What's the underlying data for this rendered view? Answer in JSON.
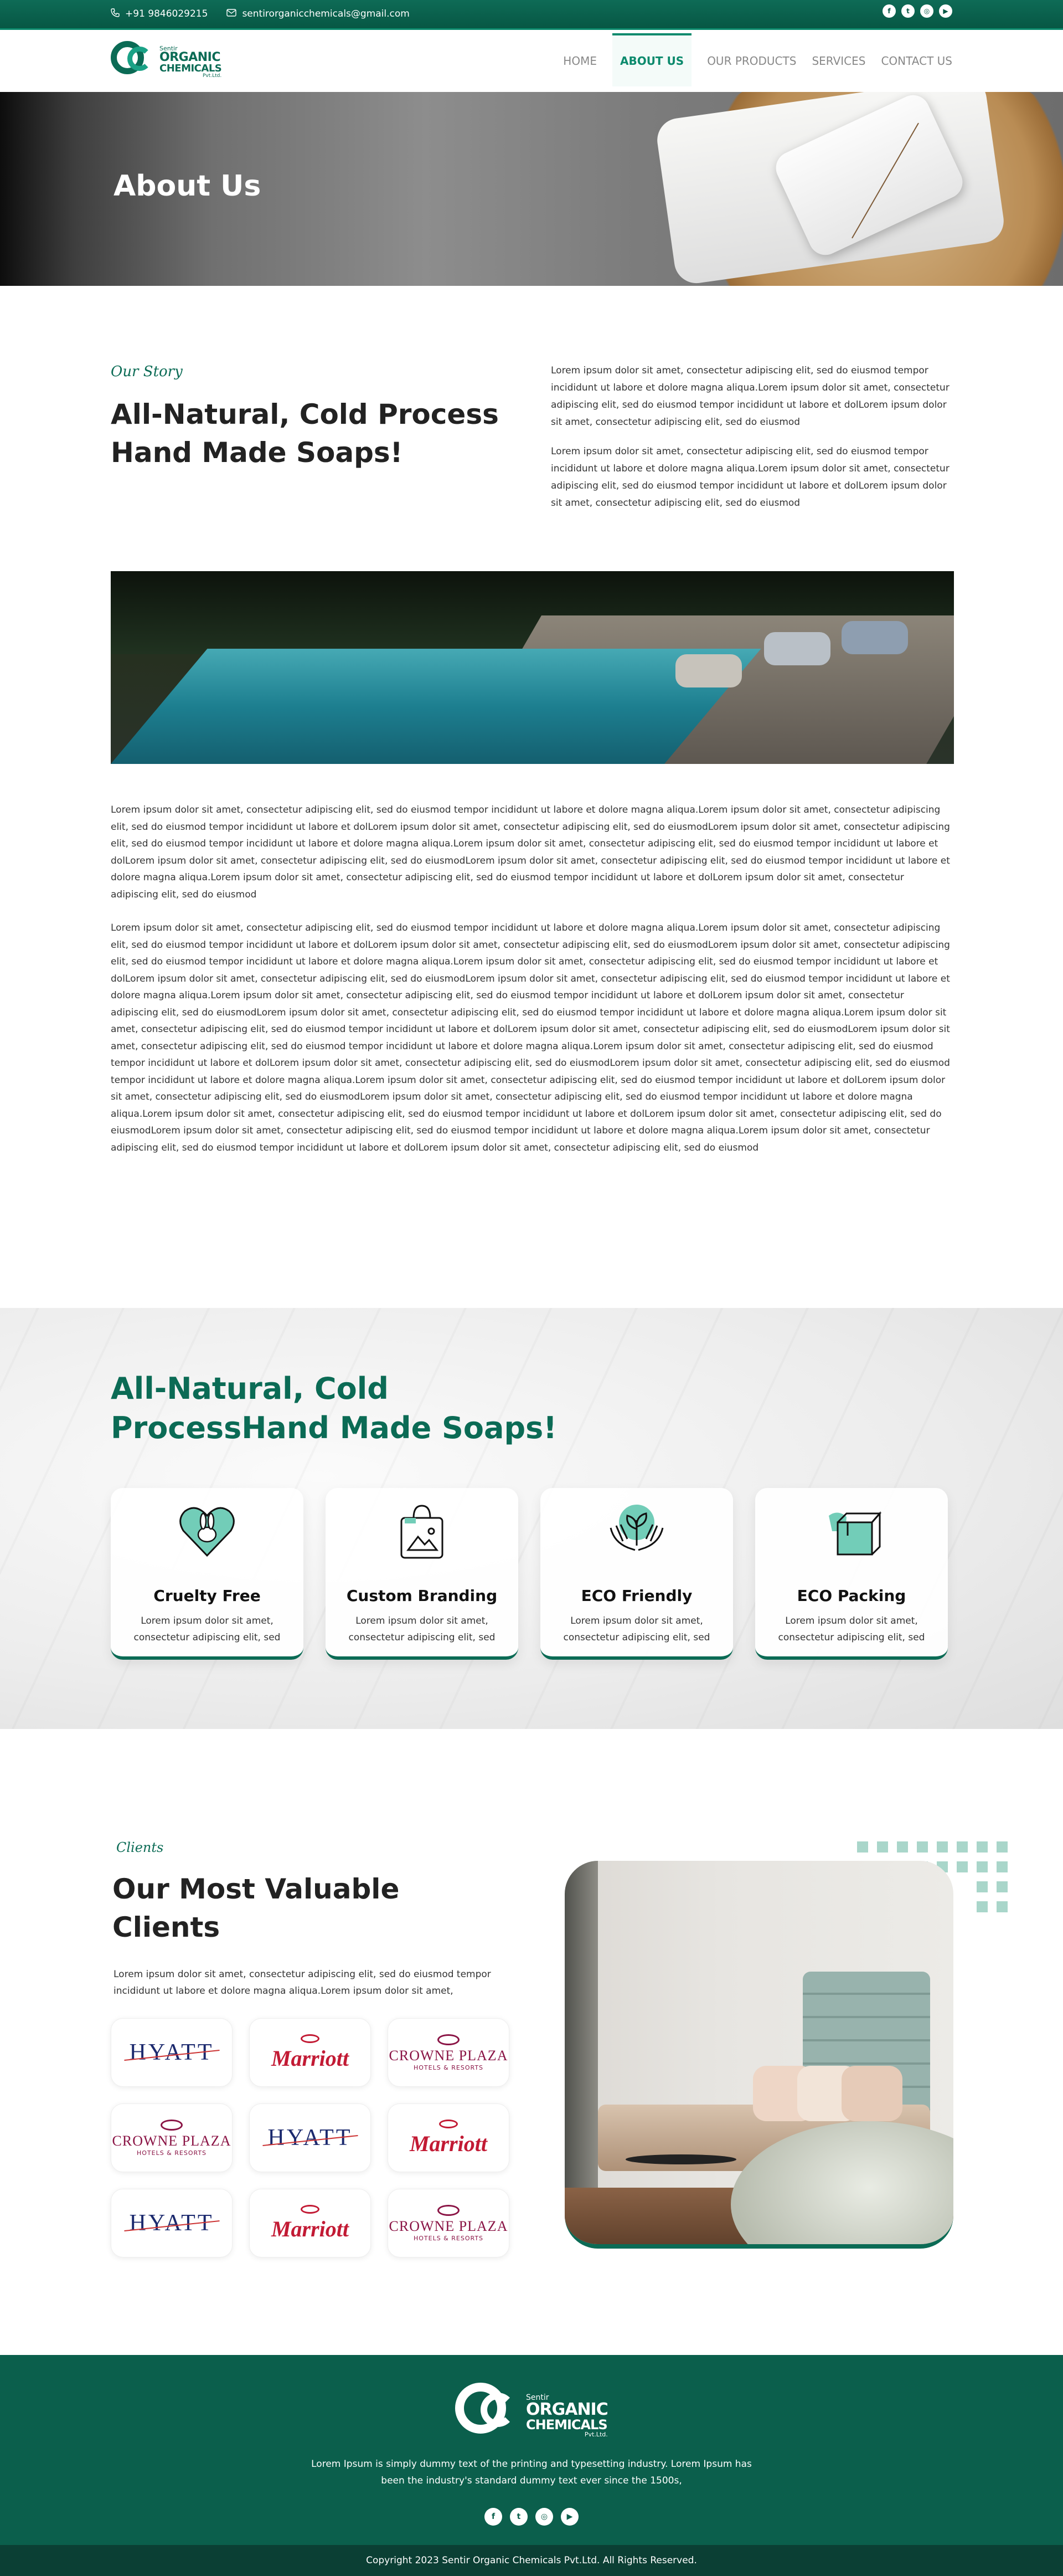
{
  "topbar": {
    "phone": "+91 9846029215",
    "email": "sentirorganicchemicals@gmail.com",
    "social": [
      {
        "icon": "facebook-icon",
        "glyph": "f"
      },
      {
        "icon": "twitter-icon",
        "glyph": "t"
      },
      {
        "icon": "instagram-icon",
        "glyph": "◎"
      },
      {
        "icon": "youtube-icon",
        "glyph": "▶"
      }
    ]
  },
  "logo": {
    "line1": "Sentir",
    "line2": "ORGANIC",
    "line3": "CHEMICALS",
    "line4": "Pvt.Ltd."
  },
  "nav": {
    "items": [
      {
        "label": "HOME",
        "active": false
      },
      {
        "label": "ABOUT US",
        "active": true
      },
      {
        "label": "OUR PRODUCTS",
        "active": false
      },
      {
        "label": "SERVICES",
        "active": false
      },
      {
        "label": "CONTACT US",
        "active": false
      }
    ]
  },
  "hero": {
    "title": "About Us"
  },
  "story": {
    "label": "Our Story",
    "heading": "All-Natural, Cold Process Hand Made Soaps!",
    "paragraphs": [
      "Lorem ipsum dolor sit amet, consectetur adipiscing elit, sed do eiusmod tempor incididunt ut labore et dolore magna aliqua.Lorem ipsum dolor sit amet, consectetur adipiscing elit, sed do eiusmod tempor incididunt ut labore et dolLorem ipsum dolor sit amet, consectetur adipiscing elit, sed do eiusmod",
      "Lorem ipsum dolor sit amet, consectetur adipiscing elit, sed do eiusmod tempor incididunt ut labore et dolore magna aliqua.Lorem ipsum dolor sit amet, consectetur adipiscing elit, sed do eiusmod tempor incididunt ut labore et dolLorem ipsum dolor sit amet, consectetur adipiscing elit, sed do eiusmod"
    ]
  },
  "body": {
    "paragraphs": [
      "Lorem ipsum dolor sit amet, consectetur adipiscing elit, sed do eiusmod tempor incididunt ut labore et dolore magna aliqua.Lorem ipsum dolor sit amet, consectetur adipiscing elit, sed do eiusmod tempor incididunt ut labore et dolLorem ipsum dolor sit amet, consectetur adipiscing elit, sed do eiusmodLorem ipsum dolor sit amet, consectetur adipiscing elit, sed do eiusmod tempor incididunt ut labore et dolore magna aliqua.Lorem ipsum dolor sit amet, consectetur adipiscing elit, sed do eiusmod tempor incididunt ut labore et dolLorem ipsum dolor sit amet, consectetur adipiscing elit, sed do eiusmodLorem ipsum dolor sit amet, consectetur adipiscing elit, sed do eiusmod tempor incididunt ut labore et dolore magna aliqua.Lorem ipsum dolor sit amet, consectetur adipiscing elit, sed do eiusmod tempor incididunt ut labore et dolLorem ipsum dolor sit amet, consectetur adipiscing elit, sed do eiusmod",
      "Lorem ipsum dolor sit amet, consectetur adipiscing elit, sed do eiusmod tempor incididunt ut labore et dolore magna aliqua.Lorem ipsum dolor sit amet, consectetur adipiscing elit, sed do eiusmod tempor incididunt ut labore et dolLorem ipsum dolor sit amet, consectetur adipiscing elit, sed do eiusmodLorem ipsum dolor sit amet, consectetur adipiscing elit, sed do eiusmod tempor incididunt ut labore et dolore magna aliqua.Lorem ipsum dolor sit amet, consectetur adipiscing elit, sed do eiusmod tempor incididunt ut labore et dolLorem ipsum dolor sit amet, consectetur adipiscing elit, sed do eiusmodLorem ipsum dolor sit amet, consectetur adipiscing elit, sed do eiusmod tempor incididunt ut labore et dolore magna aliqua.Lorem ipsum dolor sit amet, consectetur adipiscing elit, sed do eiusmod tempor incididunt ut labore et dolLorem ipsum dolor sit amet, consectetur adipiscing elit, sed do eiusmodLorem ipsum dolor sit amet, consectetur adipiscing elit, sed do eiusmod tempor incididunt ut labore et dolore magna aliqua.Lorem ipsum dolor sit amet, consectetur adipiscing elit, sed do eiusmod tempor incididunt ut labore et dolLorem ipsum dolor sit amet, consectetur adipiscing elit, sed do eiusmodLorem ipsum dolor sit amet, consectetur adipiscing elit, sed do eiusmod tempor incididunt ut labore et dolore magna aliqua.Lorem ipsum dolor sit amet, consectetur adipiscing elit, sed do eiusmod tempor incididunt ut labore et dolLorem ipsum dolor sit amet, consectetur adipiscing elit, sed do eiusmodLorem ipsum dolor sit amet, consectetur adipiscing elit, sed do eiusmod tempor incididunt ut labore et dolore magna aliqua.Lorem ipsum dolor sit amet, consectetur adipiscing elit, sed do eiusmod tempor incididunt ut labore et dolLorem ipsum dolor sit amet, consectetur adipiscing elit, sed do eiusmodLorem ipsum dolor sit amet, consectetur adipiscing elit, sed do eiusmod tempor incididunt ut labore et dolore magna aliqua.Lorem ipsum dolor sit amet, consectetur adipiscing elit, sed do eiusmod tempor incididunt ut labore et dolLorem ipsum dolor sit amet, consectetur adipiscing elit, sed do eiusmodLorem ipsum dolor sit amet, consectetur adipiscing elit, sed do eiusmod tempor incididunt ut labore et dolore magna aliqua.Lorem ipsum dolor sit amet, consectetur adipiscing elit, sed do eiusmod tempor incididunt ut labore et dolLorem ipsum dolor sit amet, consectetur adipiscing elit, sed do eiusmod"
    ]
  },
  "features": {
    "heading": "All-Natural, Cold ProcessHand Made Soaps!",
    "cards": [
      {
        "icon": "cruelty-free-rabbit-icon",
        "title": "Cruelty Free",
        "text": "Lorem ipsum dolor sit amet, consectetur adipiscing elit, sed"
      },
      {
        "icon": "custom-branding-bag-icon",
        "title": "Custom Branding",
        "text": "Lorem ipsum dolor sit amet, consectetur adipiscing elit, sed"
      },
      {
        "icon": "eco-friendly-hands-plant-icon",
        "title": "ECO Friendly",
        "text": "Lorem ipsum dolor sit amet, consectetur adipiscing elit, sed"
      },
      {
        "icon": "eco-packing-box-icon",
        "title": "ECO Packing",
        "text": "Lorem ipsum dolor sit amet, consectetur adipiscing elit, sed"
      }
    ]
  },
  "clients": {
    "label": "Clients",
    "heading": "Our Most Valuable Clients",
    "description": "Lorem ipsum dolor sit amet, consectetur adipiscing elit, sed do eiusmod tempor incididunt ut labore et dolore magna aliqua.Lorem ipsum dolor sit amet,",
    "logos": [
      {
        "brand": "hyatt",
        "text": "HYATT"
      },
      {
        "brand": "marriott",
        "text": "Marriott"
      },
      {
        "brand": "crowne",
        "text": "CROWNE PLAZA",
        "sub": "HOTELS & RESORTS"
      },
      {
        "brand": "crowne",
        "text": "CROWNE PLAZA",
        "sub": "HOTELS & RESORTS"
      },
      {
        "brand": "hyatt",
        "text": "HYATT"
      },
      {
        "brand": "marriott",
        "text": "Marriott"
      },
      {
        "brand": "hyatt",
        "text": "HYATT"
      },
      {
        "brand": "marriott",
        "text": "Marriott"
      },
      {
        "brand": "crowne",
        "text": "CROWNE PLAZA",
        "sub": "HOTELS & RESORTS"
      }
    ]
  },
  "footer": {
    "about": "Lorem Ipsum is simply dummy text of the printing and typesetting industry. Lorem Ipsum has been the industry's standard dummy text ever since the 1500s,",
    "copyright": "Copyright 2023 Sentir Organic Chemicals Pvt.Ltd. All Rights Reserved."
  },
  "colors": {
    "brand": "#0b6b55",
    "brand_light": "#0c8a6d",
    "accent_mint": "#72cdb8"
  }
}
